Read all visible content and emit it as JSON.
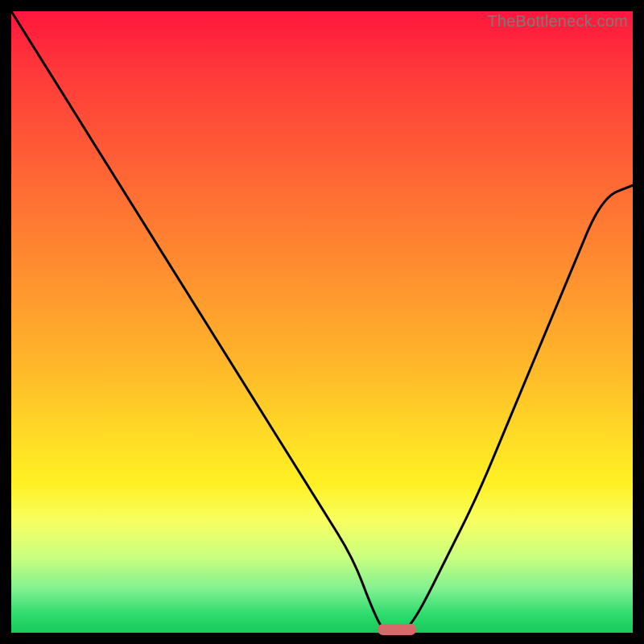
{
  "watermark": "TheBottleneck.com",
  "colors": {
    "frame_bg": "#000000",
    "curve_stroke": "#000000",
    "marker_fill": "#d66a6a",
    "gradient_stops": [
      "#ff163d",
      "#ff3a3a",
      "#ff5a36",
      "#ff7a32",
      "#ff9a2e",
      "#ffba2a",
      "#ffda26",
      "#fff024",
      "#f8ff60",
      "#c8ff80",
      "#80f090",
      "#2fdc6e",
      "#19c85a"
    ]
  },
  "chart_data": {
    "type": "line",
    "title": "",
    "xlabel": "",
    "ylabel": "",
    "xlim": [
      0,
      100
    ],
    "ylim": [
      0,
      100
    ],
    "x": [
      0,
      5,
      10,
      15,
      20,
      25,
      30,
      35,
      40,
      45,
      50,
      55,
      58,
      60,
      62,
      63,
      64,
      66,
      70,
      75,
      80,
      85,
      90,
      95,
      100
    ],
    "values": [
      100,
      92,
      84,
      76,
      68,
      60,
      52,
      44,
      36,
      28,
      20,
      12,
      4,
      0,
      0,
      0,
      1,
      4,
      12,
      22,
      34,
      46,
      58,
      70,
      72
    ],
    "annotations": [
      {
        "type": "marker",
        "shape": "rounded-rect",
        "x": 62,
        "y": 0,
        "color": "#d66a6a"
      }
    ],
    "notes": "Background is a vertical red→yellow→green gradient; curve is a black V-shaped line reaching its minimum (touching the bottom edge) near x≈62; a small rounded red pill marker sits at the curve's minimum."
  }
}
